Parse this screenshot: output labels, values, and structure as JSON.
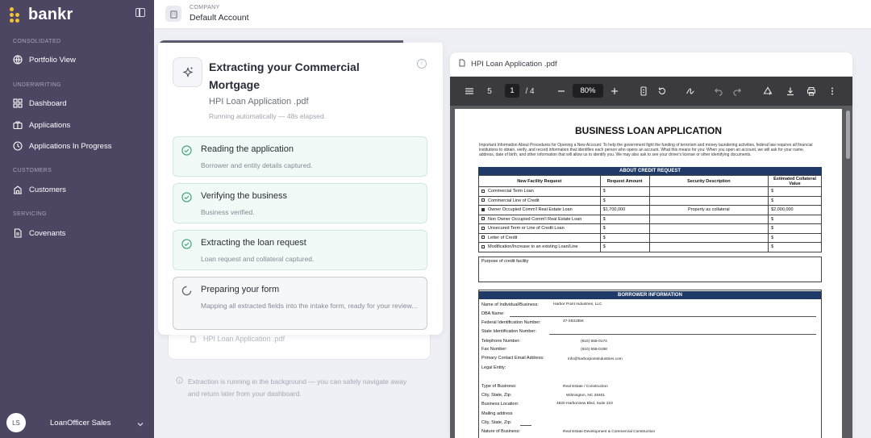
{
  "app": {
    "name": "bankr"
  },
  "sidebar": {
    "sections": [
      {
        "label": "CONSOLIDATED"
      },
      {
        "label": "UNDERWRITING"
      },
      {
        "label": "CUSTOMERS"
      },
      {
        "label": "SERVICING"
      }
    ],
    "items": [
      {
        "label": "Portfolio View",
        "icon": "globe-icon"
      },
      {
        "label": "Dashboard",
        "icon": "grid-icon"
      },
      {
        "label": "Applications",
        "icon": "briefcase-icon"
      },
      {
        "label": "Applications In Progress",
        "icon": "clock-icon"
      },
      {
        "label": "Customers",
        "icon": "building-icon"
      },
      {
        "label": "Covenants",
        "icon": "document-icon"
      }
    ],
    "user": {
      "initials": "LS",
      "name": "LoanOfficer Sales"
    }
  },
  "header": {
    "company_label": "COMPANY",
    "company_name": "Default Account"
  },
  "extraction": {
    "title": "Extracting your Commercial Mortgage",
    "file": "HPI Loan Application .pdf",
    "status": "Running automatically — 48s elapsed.",
    "progress": 0.86,
    "steps": [
      {
        "title": "Reading the application",
        "desc": "Borrower and entity details captured.",
        "state": "done"
      },
      {
        "title": "Verifying the business",
        "desc": "Business verified.",
        "state": "done"
      },
      {
        "title": "Extracting the loan request",
        "desc": "Loan request and collateral captured.",
        "state": "done"
      },
      {
        "title": "Preparing your form",
        "desc": "Mapping all extracted fields into the intake form, ready for your review...",
        "state": "in-progress"
      }
    ],
    "attached_file": "HPI Loan Application .pdf",
    "footnote": "Extraction is running in the background — you can safely navigate away and return later from your dashboard."
  },
  "viewer": {
    "file_name": "HPI Loan Application .pdf",
    "toolbar": {
      "outline_count": "5",
      "page": "1",
      "total_pages": "/ 4",
      "zoom": "80%"
    },
    "doc": {
      "title": "BUSINESS LOAN APPLICATION",
      "intro": "Important Information About Procedures for Opening a New Account: To help the government fight the funding of terrorism and money laundering activities, federal law requires all financial institutions to obtain, verify, and record information that identifies each person who opens an account. What this means for you: When you open an account, we will ask for your name, address, date of birth, and other information that will allow us to identify you. We may also ask to see your driver's license or other identifying documents.",
      "credit_header": "ABOUT CREDIT REQUEST",
      "columns": [
        "New Facility Request",
        "Request Amount",
        "Security Description",
        "Estimated Collateral Value"
      ],
      "rows": [
        {
          "facility": "Commercial Term Loan",
          "amount": "$",
          "security": "",
          "collateral": "$",
          "checked": false
        },
        {
          "facility": "Commercial Line of Credit",
          "amount": "$",
          "security": "",
          "collateral": "$",
          "checked": false
        },
        {
          "facility": "Owner Occupied Comm'l Real Estate Loan",
          "amount": "$1,700,000",
          "security": "Property as collateral",
          "collateral": "$2,000,000",
          "checked": true
        },
        {
          "facility": "Non Owner Occupied Comm'l Real Estate Loan",
          "amount": "$",
          "security": "",
          "collateral": "$",
          "checked": false
        },
        {
          "facility": "Unsecured Term or Line of Credit Loan",
          "amount": "$",
          "security": "",
          "collateral": "$",
          "checked": false
        },
        {
          "facility": "Letter of Credit",
          "amount": "$",
          "security": "",
          "collateral": "$",
          "checked": false
        },
        {
          "facility": "Modification/Increase to an existing Loan/Line",
          "amount": "$",
          "security": "",
          "collateral": "$",
          "checked": false
        }
      ],
      "purpose_label": "Purpose of credit facility",
      "borrower_header": "BORROWER INFORMATION",
      "borrower": {
        "name_label": "Name of Individual/Business:",
        "name_value": "Harbor Point Industries, LLC",
        "dba_label": "DBA Name:",
        "fein_label": "Federal Identification Number:",
        "fein_value": "47-2831856",
        "state_id_label": "State Identification Number:",
        "phone_label": "Telephone Number:",
        "phone_value": "(910) 555-0174",
        "fax_label": "Fax Number:",
        "fax_value": "(910) 555-0198",
        "email_label": "Primary Contact Email Address:",
        "email_value": "info@harborpointindustries.com",
        "entity_label": "Legal Entity:",
        "type_label": "Type of Business:",
        "type_value": "Real Estate / Construction",
        "csz_label": "City, State, Zip:",
        "csz_value": "Wilmington, NC 28401",
        "location_label": "Business Location:",
        "location_value": "4820 Harborview Blvd, Suite 210",
        "mailing_label": "Mailing address",
        "csz2_label": "City, State, Zip:",
        "nature_label": "Nature of Business:",
        "nature_value": "Real Estate Development & Commercial Construction"
      }
    }
  }
}
